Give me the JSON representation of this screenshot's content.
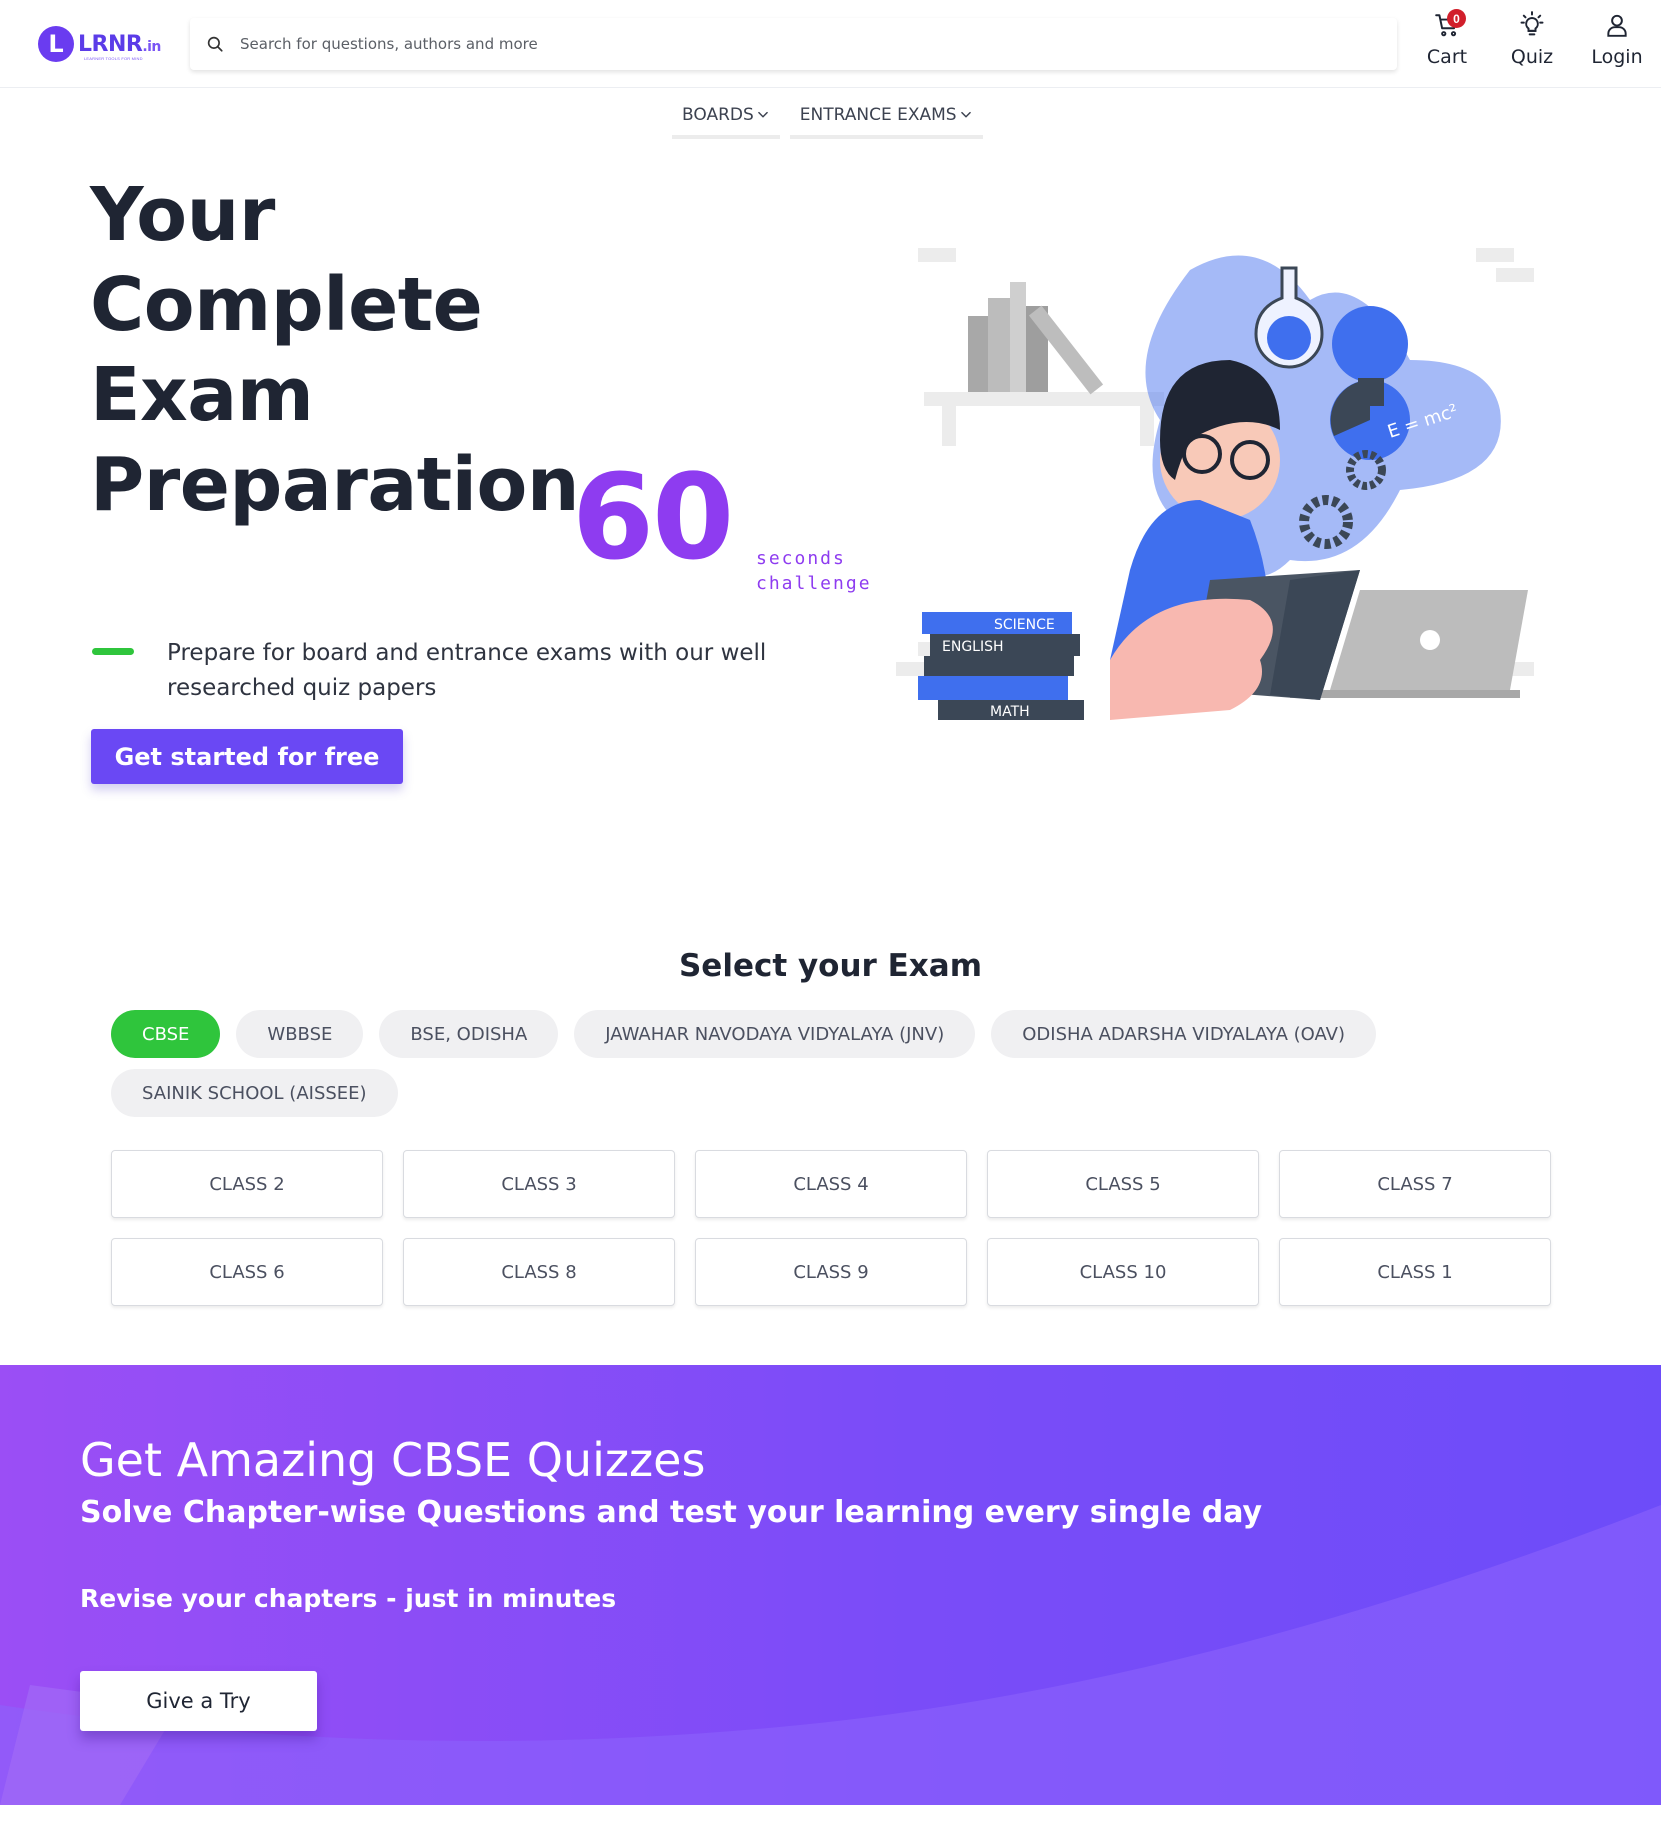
{
  "header": {
    "logo_text": "LRNR",
    "logo_suffix": ".in",
    "logo_mark": "L",
    "logo_tagline": "LEARNER TOOLS FOR MIND",
    "search_placeholder": "Search for questions, authors and more",
    "cart_label": "Cart",
    "cart_count": "0",
    "quiz_label": "Quiz",
    "login_label": "Login"
  },
  "nav": {
    "boards_label": "BOARDS",
    "entrance_label": "ENTRANCE EXAMS"
  },
  "hero": {
    "title_line1": "Your",
    "title_line2": "Complete",
    "title_line3": "Exam",
    "title_line4": "Preparation",
    "big_number": "60",
    "challenge_line1": "seconds",
    "challenge_line2": "challenge",
    "subtitle": "Prepare for board and entrance exams with our well researched quiz papers",
    "cta_label": "Get started for free",
    "book_labels": [
      "SCIENCE",
      "ENGLISH",
      "MATH"
    ],
    "formula": "E = mc²"
  },
  "exam": {
    "title": "Select your Exam",
    "boards": [
      {
        "label": "CBSE",
        "active": true
      },
      {
        "label": "WBBSE",
        "active": false
      },
      {
        "label": "BSE, ODISHA",
        "active": false
      },
      {
        "label": "JAWAHAR NAVODAYA VIDYALAYA (JNV)",
        "active": false
      },
      {
        "label": "ODISHA ADARSHA VIDYALAYA (OAV)",
        "active": false
      },
      {
        "label": "SAINIK SCHOOL (AISSEE)",
        "active": false
      }
    ],
    "classes": [
      "CLASS 2",
      "CLASS 3",
      "CLASS 4",
      "CLASS 5",
      "CLASS 7",
      "CLASS 6",
      "CLASS 8",
      "CLASS 9",
      "CLASS 10",
      "CLASS 1"
    ]
  },
  "banner": {
    "heading": "Get Amazing CBSE Quizzes",
    "subheading": "Solve Chapter-wise Questions and test your learning every single day",
    "tagline": "Revise your chapters - just in minutes",
    "button_label": "Give a Try"
  },
  "colors": {
    "accent_purple": "#8e3cf0",
    "cta_purple": "#6a48f4",
    "active_green": "#2fc53c",
    "cart_badge_red": "#d11f2b"
  }
}
